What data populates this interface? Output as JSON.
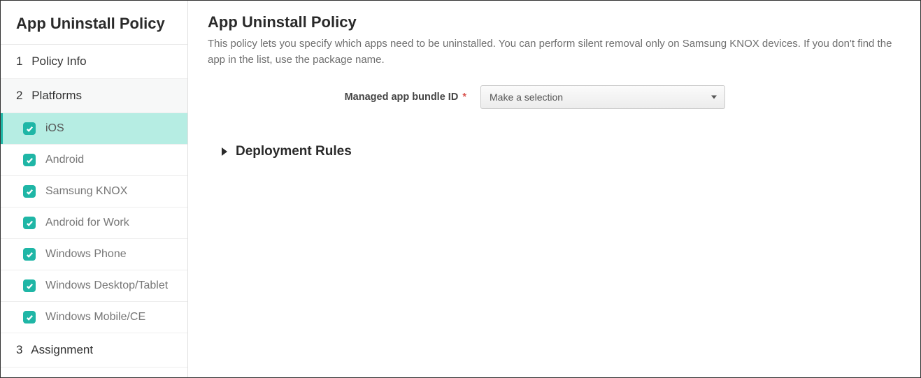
{
  "sidebar": {
    "title": "App Uninstall Policy",
    "steps": [
      {
        "num": "1",
        "label": "Policy Info"
      },
      {
        "num": "2",
        "label": "Platforms"
      },
      {
        "num": "3",
        "label": "Assignment"
      }
    ],
    "platforms": [
      {
        "label": "iOS",
        "active": true
      },
      {
        "label": "Android",
        "active": false
      },
      {
        "label": "Samsung KNOX",
        "active": false
      },
      {
        "label": "Android for Work",
        "active": false
      },
      {
        "label": "Windows Phone",
        "active": false
      },
      {
        "label": "Windows Desktop/Tablet",
        "active": false
      },
      {
        "label": "Windows Mobile/CE",
        "active": false
      }
    ]
  },
  "main": {
    "title": "App Uninstall Policy",
    "description": "This policy lets you specify which apps need to be uninstalled. You can perform silent removal only on Samsung KNOX devices. If you don't find the app in the list, use the package name.",
    "form": {
      "bundle_label": "Managed app bundle ID",
      "required_mark": "*",
      "select_placeholder": "Make a selection"
    },
    "deployment_rules_label": "Deployment Rules"
  }
}
